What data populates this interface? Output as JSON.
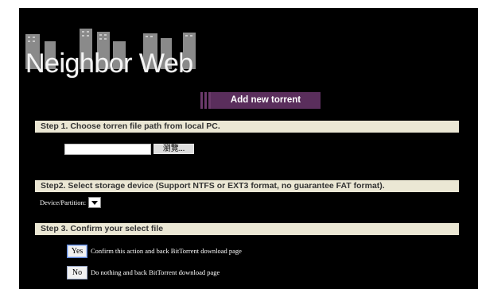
{
  "logo": {
    "text": "Neighbor Web",
    "icon": "city-buildings-icon"
  },
  "banner": {
    "label": "Add new torrent"
  },
  "step1": {
    "title": "Step 1. Choose torren file path from local PC.",
    "file_value": "",
    "browse_label": "瀏覽..."
  },
  "step2": {
    "title": "Step2. Select storage device (Support NTFS or EXT3 format, no guarantee FAT format).",
    "device_label": "Device/Partition:",
    "selected": ""
  },
  "step3": {
    "title": "Step 3. Confirm your select file",
    "yes_label": "Yes",
    "yes_text": "Confirm this action and back BitTorrent download page",
    "no_label": "No",
    "no_text": "Do nothing and back BitTorrent download page"
  },
  "colors": {
    "background": "#000000",
    "step_bar": "#ebe7d4",
    "banner": "#5a2e5c"
  }
}
